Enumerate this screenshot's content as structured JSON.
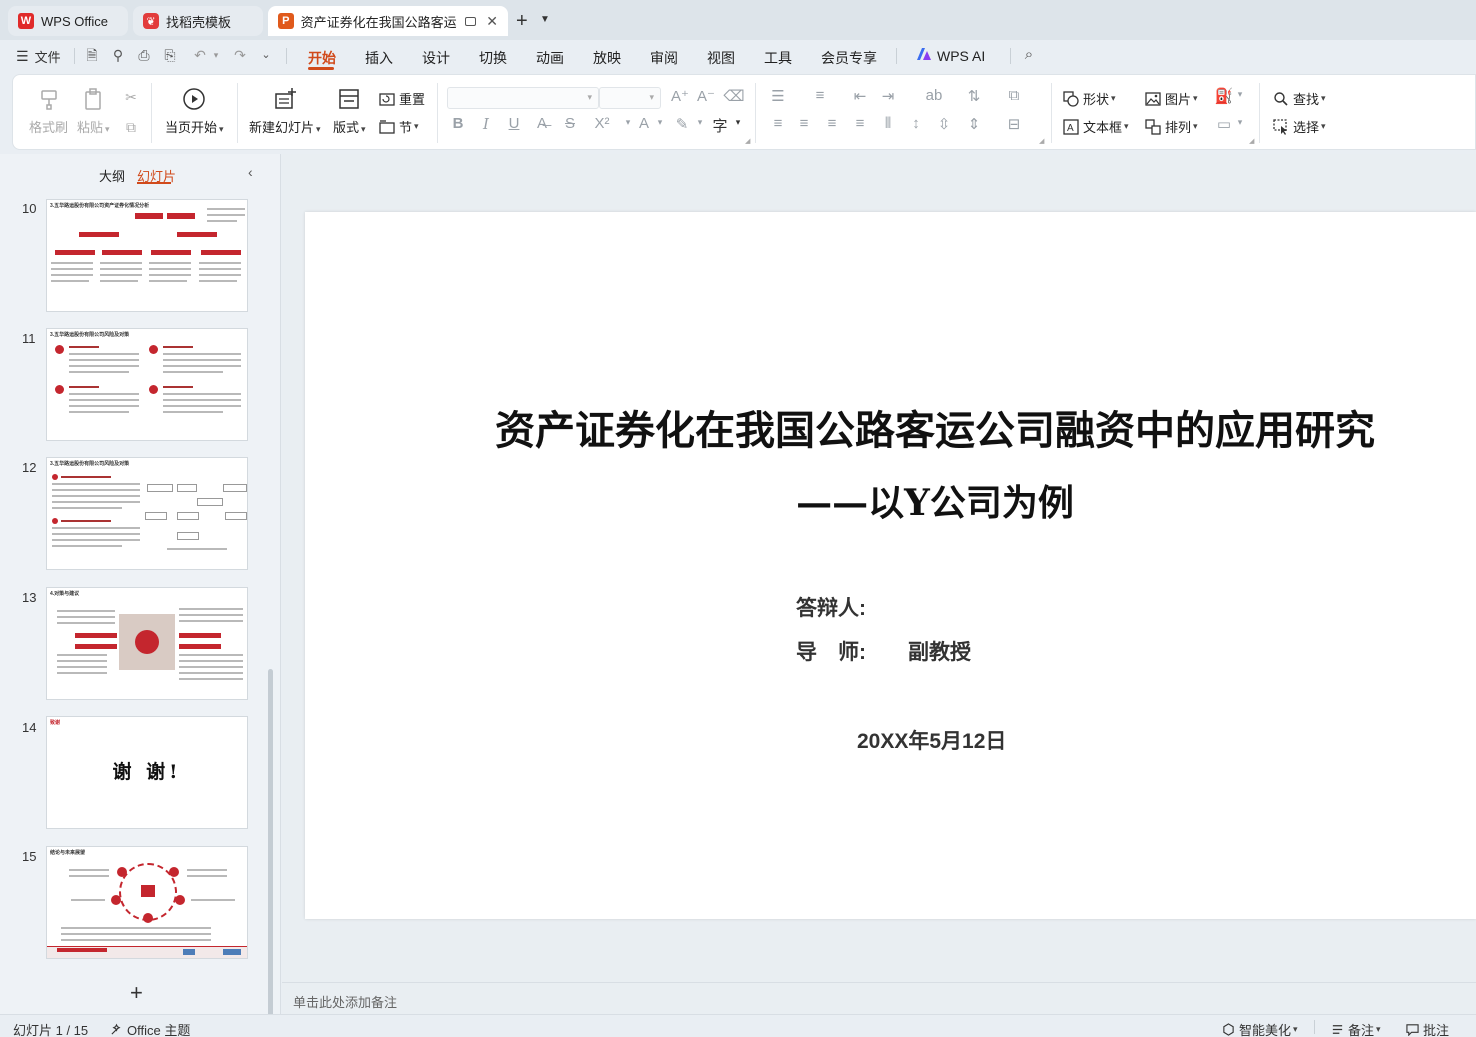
{
  "tabs": [
    {
      "label": "WPS Office",
      "state": "inactive"
    },
    {
      "label": "找稻壳模板",
      "state": "inactive"
    },
    {
      "label": "资产证券化在我国公路客运公司的",
      "state": "active"
    }
  ],
  "menu": {
    "file": "文件",
    "tabs": [
      "开始",
      "插入",
      "设计",
      "切换",
      "动画",
      "放映",
      "审阅",
      "视图",
      "工具",
      "会员专享"
    ],
    "active_tab": "开始",
    "wps_ai": "WPS AI"
  },
  "ribbon": {
    "format_painter": "格式刷",
    "paste": "粘贴",
    "from_current": "当页开始",
    "new_slide": "新建幻灯片",
    "layout": "版式",
    "reset": "重置",
    "section": "节",
    "shape": "形状",
    "picture": "图片",
    "textbox": "文本框",
    "arrange": "排列",
    "find": "查找",
    "select": "选择"
  },
  "left_panel": {
    "outline_tab": "大纲",
    "slides_tab": "幻灯片",
    "active_tab": "幻灯片",
    "thumbnails": [
      {
        "number": "10",
        "title": "3.五华路运股份有限公司资产证券化情况分析"
      },
      {
        "number": "11",
        "title": "3.五华路运股份有限公司风险及对策"
      },
      {
        "number": "12",
        "title": "3.五华路运股份有限公司风险及对策"
      },
      {
        "number": "13",
        "title": "4.对策与建议"
      },
      {
        "number": "14",
        "title": "致谢",
        "big_text": "谢 谢!"
      },
      {
        "number": "15",
        "title": "结论与未来展望"
      }
    ]
  },
  "slide": {
    "title": "资产证券化在我国公路客运公司融资中的应用研究",
    "subtitle": "——以Y公司为例",
    "defender_label": "答辩人:",
    "advisor_label": "导　师:",
    "advisor_title": "副教授",
    "date": "20XX年5月12日"
  },
  "notes_placeholder": "单击此处添加备注",
  "status": {
    "slide_counter": "幻灯片 1 / 15",
    "theme": "Office 主题",
    "smart_beautify": "智能美化",
    "notes": "备注",
    "comments": "批注"
  },
  "colors": {
    "accent": "#d14a1b",
    "wps_red": "#e02a2a",
    "theme_red": "#c4262e"
  }
}
